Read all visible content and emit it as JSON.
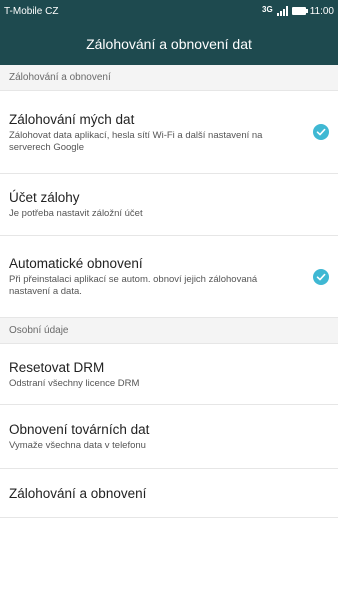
{
  "status_bar": {
    "carrier": "T-Mobile CZ",
    "network": "3G",
    "time": "11:00"
  },
  "app_bar": {
    "title": "Zálohování a obnovení dat"
  },
  "sections": [
    {
      "header": "Zálohování a obnovení",
      "items": [
        {
          "title": "Zálohování mých dat",
          "subtitle": "Zálohovat data aplikací, hesla sítí Wi-Fi a další nastavení na serverech Google",
          "checked": true
        },
        {
          "title": "Účet zálohy",
          "subtitle": "Je potřeba nastavit záložní účet",
          "checked": false
        },
        {
          "title": "Automatické obnovení",
          "subtitle": "Při přeinstalaci aplikací se autom. obnoví jejich zálohovaná nastavení a data.",
          "checked": true
        }
      ]
    },
    {
      "header": "Osobní údaje",
      "items": [
        {
          "title": "Resetovat DRM",
          "subtitle": "Odstraní všechny licence DRM"
        },
        {
          "title": "Obnovení továrních dat",
          "subtitle": "Vymaže všechna data v telefonu"
        },
        {
          "title": "Zálohování a obnovení",
          "subtitle": ""
        }
      ]
    }
  ],
  "colors": {
    "app_bar": "#1e4a4f",
    "check_accent": "#3fb8d3",
    "section_header_bg": "#f4f4f4"
  },
  "icons": {
    "check": "check-circle-icon",
    "signal": "signal-icon",
    "battery": "battery-icon"
  }
}
